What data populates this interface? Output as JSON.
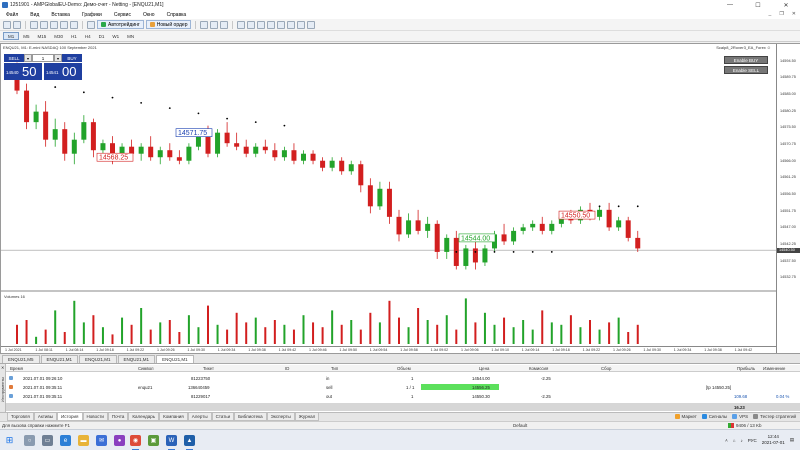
{
  "window": {
    "title": "1251901 - AMPGlobalEU-Demo: Демо-счет - Netting - [ENQU21,M1]",
    "controls": {
      "minimize": "—",
      "maximize": "☐",
      "close": "✕"
    }
  },
  "menu": {
    "items": [
      "Файл",
      "Вид",
      "Вставка",
      "Графики",
      "Сервис",
      "Окно",
      "Справка"
    ],
    "child_controls": [
      "_",
      "❐",
      "✕"
    ]
  },
  "toolbar": {
    "autotrade_label": "Автотрейдинг",
    "new_order_label": "Новый ордер"
  },
  "timeframes": {
    "items": [
      "M1",
      "M5",
      "M15",
      "M30",
      "H1",
      "H4",
      "D1",
      "W1",
      "MN"
    ],
    "active": "M1"
  },
  "chart": {
    "header": "ENQU21, M1: E-mini NASDAQ 100 September 2021",
    "ea_name": "Scalp8_2Rover3_EA_Forex ☺",
    "enable_buy_label": "Enable BUY",
    "enable_sell_label": "Enable SELL",
    "trade_panel": {
      "sell_label": "SELL",
      "dropdown": "▾",
      "volume": "1",
      "buy_label": "BUY",
      "sell_price_small": "14540",
      "sell_price_big": "50",
      "buy_price_small": "14541",
      "buy_price_big": "00"
    },
    "volumes_label": "Volumes 16",
    "price_axis": [
      "14594.50",
      "14589.75",
      "14585.00",
      "14580.25",
      "14575.50",
      "14570.75",
      "14566.00",
      "14561.25",
      "14556.50",
      "14551.75",
      "14547.00",
      "14542.25",
      "14537.50",
      "14532.75"
    ],
    "current_price": "14540.50",
    "time_axis": [
      "1 Jul 2021",
      "1 Jul 08:11",
      "1 Jul 08:14",
      "1 Jul 09:18",
      "1 Jul 09:22",
      "1 Jul 09:26",
      "1 Jul 09:30",
      "1 Jul 09:34",
      "1 Jul 09:38",
      "1 Jul 09:42",
      "1 Jul 09:46",
      "1 Jul 09:50",
      "1 Jul 09:54",
      "1 Jul 09:58",
      "1 Jul 09:02",
      "1 Jul 09:06",
      "1 Jul 09:10",
      "1 Jul 09:14",
      "1 Jul 09:18",
      "1 Jul 09:22",
      "1 Jul 09:26",
      "1 Jul 09:30",
      "1 Jul 09:34",
      "1 Jul 09:38",
      "1 Jul 09:42"
    ],
    "annotations": {
      "price_label_1": "14568.25",
      "price_label_2": "14571.75",
      "price_label_3": "14544.00",
      "price_label_4": "14550.50"
    }
  },
  "chart_data": {
    "type": "candlestick",
    "title": "ENQU21, M1: E-mini NASDAQ 100 September 2021",
    "ylim": [
      14530.0,
      14597.0
    ],
    "colors": {
      "up": "#22a32a",
      "down": "#d21f1f",
      "dots": "#000000"
    },
    "candles": [
      {
        "o": 14590.0,
        "h": 14594.0,
        "c": 14586.0,
        "l": 14585.0
      },
      {
        "o": 14586.0,
        "h": 14588.0,
        "c": 14577.0,
        "l": 14575.0
      },
      {
        "o": 14577.0,
        "h": 14582.0,
        "c": 14580.0,
        "l": 14575.0
      },
      {
        "o": 14580.0,
        "h": 14583.0,
        "c": 14572.0,
        "l": 14570.0
      },
      {
        "o": 14572.0,
        "h": 14578.0,
        "c": 14575.0,
        "l": 14570.0
      },
      {
        "o": 14575.0,
        "h": 14577.0,
        "c": 14568.0,
        "l": 14566.0
      },
      {
        "o": 14568.0,
        "h": 14574.0,
        "c": 14572.0,
        "l": 14565.0
      },
      {
        "o": 14572.0,
        "h": 14579.0,
        "c": 14577.0,
        "l": 14571.0
      },
      {
        "o": 14577.0,
        "h": 14578.0,
        "c": 14569.0,
        "l": 14567.0
      },
      {
        "o": 14569.0,
        "h": 14572.0,
        "c": 14571.0,
        "l": 14567.0
      },
      {
        "o": 14571.0,
        "h": 14573.0,
        "c": 14567.0,
        "l": 14565.0
      },
      {
        "o": 14567.0,
        "h": 14571.0,
        "c": 14570.0,
        "l": 14566.0
      },
      {
        "o": 14570.0,
        "h": 14572.0,
        "c": 14568.0,
        "l": 14567.0
      },
      {
        "o": 14568.0,
        "h": 14571.0,
        "c": 14570.0,
        "l": 14566.0
      },
      {
        "o": 14570.0,
        "h": 14573.0,
        "c": 14567.0,
        "l": 14566.0
      },
      {
        "o": 14567.0,
        "h": 14570.0,
        "c": 14569.0,
        "l": 14565.0
      },
      {
        "o": 14569.0,
        "h": 14571.0,
        "c": 14567.0,
        "l": 14566.0
      },
      {
        "o": 14567.0,
        "h": 14569.0,
        "c": 14566.0,
        "l": 14565.0
      },
      {
        "o": 14566.0,
        "h": 14571.0,
        "c": 14570.0,
        "l": 14565.0
      },
      {
        "o": 14570.0,
        "h": 14575.0,
        "c": 14573.0,
        "l": 14569.0
      },
      {
        "o": 14573.0,
        "h": 14576.0,
        "c": 14568.0,
        "l": 14567.0
      },
      {
        "o": 14568.0,
        "h": 14575.0,
        "c": 14574.0,
        "l": 14567.0
      },
      {
        "o": 14574.0,
        "h": 14577.0,
        "c": 14571.0,
        "l": 14570.0
      },
      {
        "o": 14571.0,
        "h": 14574.0,
        "c": 14570.0,
        "l": 14569.0
      },
      {
        "o": 14570.0,
        "h": 14572.0,
        "c": 14568.0,
        "l": 14567.0
      },
      {
        "o": 14568.0,
        "h": 14571.0,
        "c": 14570.0,
        "l": 14567.0
      },
      {
        "o": 14570.0,
        "h": 14572.0,
        "c": 14569.0,
        "l": 14568.0
      },
      {
        "o": 14569.0,
        "h": 14571.0,
        "c": 14567.0,
        "l": 14566.0
      },
      {
        "o": 14567.0,
        "h": 14570.0,
        "c": 14569.0,
        "l": 14566.0
      },
      {
        "o": 14569.0,
        "h": 14571.0,
        "c": 14566.0,
        "l": 14565.0
      },
      {
        "o": 14566.0,
        "h": 14569.0,
        "c": 14568.0,
        "l": 14565.0
      },
      {
        "o": 14568.0,
        "h": 14569.0,
        "c": 14566.0,
        "l": 14565.0
      },
      {
        "o": 14566.0,
        "h": 14567.0,
        "c": 14564.0,
        "l": 14563.0
      },
      {
        "o": 14564.0,
        "h": 14567.0,
        "c": 14566.0,
        "l": 14563.0
      },
      {
        "o": 14566.0,
        "h": 14567.0,
        "c": 14563.0,
        "l": 14562.0
      },
      {
        "o": 14563.0,
        "h": 14566.0,
        "c": 14565.0,
        "l": 14562.0
      },
      {
        "o": 14565.0,
        "h": 14566.0,
        "c": 14559.0,
        "l": 14557.0
      },
      {
        "o": 14559.0,
        "h": 14561.0,
        "c": 14553.0,
        "l": 14551.0
      },
      {
        "o": 14553.0,
        "h": 14560.0,
        "c": 14558.0,
        "l": 14552.0
      },
      {
        "o": 14558.0,
        "h": 14560.0,
        "c": 14550.0,
        "l": 14548.0
      },
      {
        "o": 14550.0,
        "h": 14552.0,
        "c": 14545.0,
        "l": 14543.0
      },
      {
        "o": 14545.0,
        "h": 14551.0,
        "c": 14549.0,
        "l": 14544.0
      },
      {
        "o": 14549.0,
        "h": 14552.0,
        "c": 14546.0,
        "l": 14545.0
      },
      {
        "o": 14546.0,
        "h": 14550.0,
        "c": 14548.0,
        "l": 14544.0
      },
      {
        "o": 14548.0,
        "h": 14549.0,
        "c": 14540.0,
        "l": 14538.0
      },
      {
        "o": 14540.0,
        "h": 14545.0,
        "c": 14544.0,
        "l": 14538.0
      },
      {
        "o": 14544.0,
        "h": 14546.0,
        "c": 14536.0,
        "l": 14535.0
      },
      {
        "o": 14536.0,
        "h": 14542.0,
        "c": 14541.0,
        "l": 14535.0
      },
      {
        "o": 14541.0,
        "h": 14545.0,
        "c": 14537.0,
        "l": 14535.0
      },
      {
        "o": 14537.0,
        "h": 14542.0,
        "c": 14541.0,
        "l": 14536.0
      },
      {
        "o": 14541.0,
        "h": 14546.0,
        "c": 14545.0,
        "l": 14540.0
      },
      {
        "o": 14545.0,
        "h": 14548.0,
        "c": 14543.0,
        "l": 14542.0
      },
      {
        "o": 14543.0,
        "h": 14547.0,
        "c": 14546.0,
        "l": 14542.0
      },
      {
        "o": 14546.0,
        "h": 14548.0,
        "c": 14547.0,
        "l": 14545.0
      },
      {
        "o": 14547.0,
        "h": 14549.0,
        "c": 14548.0,
        "l": 14546.0
      },
      {
        "o": 14548.0,
        "h": 14550.0,
        "c": 14546.0,
        "l": 14545.0
      },
      {
        "o": 14546.0,
        "h": 14549.0,
        "c": 14548.0,
        "l": 14545.0
      },
      {
        "o": 14548.0,
        "h": 14551.0,
        "c": 14550.0,
        "l": 14547.0
      },
      {
        "o": 14550.0,
        "h": 14552.0,
        "c": 14549.0,
        "l": 14548.0
      },
      {
        "o": 14549.0,
        "h": 14553.0,
        "c": 14552.0,
        "l": 14548.0
      },
      {
        "o": 14552.0,
        "h": 14554.0,
        "c": 14550.0,
        "l": 14549.0
      },
      {
        "o": 14550.0,
        "h": 14553.0,
        "c": 14552.0,
        "l": 14549.0
      },
      {
        "o": 14552.0,
        "h": 14554.0,
        "c": 14547.0,
        "l": 14546.0
      },
      {
        "o": 14547.0,
        "h": 14550.0,
        "c": 14549.0,
        "l": 14546.0
      },
      {
        "o": 14549.0,
        "h": 14550.0,
        "c": 14544.0,
        "l": 14543.0
      },
      {
        "o": 14544.0,
        "h": 14546.0,
        "c": 14541.0,
        "l": 14540.0
      }
    ],
    "dots": [
      {
        "i": 4,
        "v": 14587.0
      },
      {
        "i": 7,
        "v": 14585.5
      },
      {
        "i": 10,
        "v": 14584.0
      },
      {
        "i": 13,
        "v": 14582.5
      },
      {
        "i": 16,
        "v": 14581.0
      },
      {
        "i": 19,
        "v": 14579.5
      },
      {
        "i": 22,
        "v": 14578.0
      },
      {
        "i": 25,
        "v": 14577.0
      },
      {
        "i": 28,
        "v": 14576.0
      },
      {
        "i": 46,
        "v": 14540.0
      },
      {
        "i": 48,
        "v": 14540.0
      },
      {
        "i": 50,
        "v": 14540.0
      },
      {
        "i": 52,
        "v": 14540.0
      },
      {
        "i": 54,
        "v": 14540.0
      },
      {
        "i": 56,
        "v": 14540.0
      },
      {
        "i": 61,
        "v": 14553.0
      },
      {
        "i": 63,
        "v": 14553.0
      },
      {
        "i": 65,
        "v": 14553.0
      }
    ],
    "volumes": [
      8,
      10,
      3,
      6,
      14,
      5,
      18,
      9,
      12,
      7,
      4,
      11,
      8,
      15,
      6,
      9,
      10,
      5,
      12,
      7,
      16,
      8,
      6,
      13,
      9,
      11,
      7,
      10,
      8,
      6,
      12,
      9,
      7,
      14,
      8,
      10,
      6,
      13,
      9,
      18,
      11,
      7,
      15,
      10,
      8,
      12,
      6,
      19,
      9,
      13,
      8,
      11,
      7,
      10,
      6,
      14,
      9,
      8,
      12,
      7,
      10,
      6,
      9,
      11,
      5,
      8
    ],
    "volume_ylim": [
      0,
      20
    ]
  },
  "chart_tabs": {
    "items": [
      "ENQU21,M5",
      "ENQU21,M1",
      "ENQU21,M1",
      "ENQU21,M1",
      "ENQU21,M1"
    ],
    "active_index": 4
  },
  "toolbox": {
    "side_label": "Инструменты",
    "close": "✕",
    "columns": [
      "Время",
      "Символ",
      "Тикет",
      "ID",
      "Тип",
      "Объем",
      "Цена",
      "Комиссия",
      "Сбор",
      "Прибыль",
      "Изменение"
    ],
    "rows": [
      {
        "time": "2021.07.01 09:26:10",
        "symbol": "",
        "ticket": "81223750",
        "id": "",
        "type": "in",
        "volume": "1",
        "price": "14544.00",
        "commission": "-2.25",
        "fee": "",
        "profit": "",
        "change": ""
      },
      {
        "time": "2021.07.01 09:35:11",
        "symbol": "enqu21",
        "ticket": "136640459",
        "id": "",
        "type": "sell",
        "volume": "1 / 1",
        "price": "14556.25",
        "commission": "",
        "fee": "",
        "profit": "[tp 14550.25]",
        "change": ""
      },
      {
        "time": "2021.07.01 09:35:11",
        "symbol": "",
        "ticket": "81229017",
        "id": "",
        "type": "out",
        "volume": "1",
        "price": "14550.30",
        "commission": "-2.25",
        "fee": "",
        "profit": "109.68",
        "change": "0.04 %"
      }
    ],
    "summary_profit": "16.23"
  },
  "bottom_tabs": {
    "items": [
      "Торговля",
      "Активы",
      "История",
      "Новости",
      "Почта",
      "Календарь",
      "Компания",
      "Алерты",
      "Статьи",
      "Библиотека",
      "Эксперты",
      "Журнал"
    ],
    "active_index": 2,
    "right_links": [
      "Маркет",
      "Сигналы",
      "VPS",
      "Тестер стратегий"
    ]
  },
  "status": {
    "help": "Для вызова справки нажмите F1",
    "profile": "Default",
    "net": "9406 / 13 Kb"
  },
  "taskbar": {
    "time": "12:44",
    "date": "2021-07-01",
    "lang": "РУС"
  }
}
